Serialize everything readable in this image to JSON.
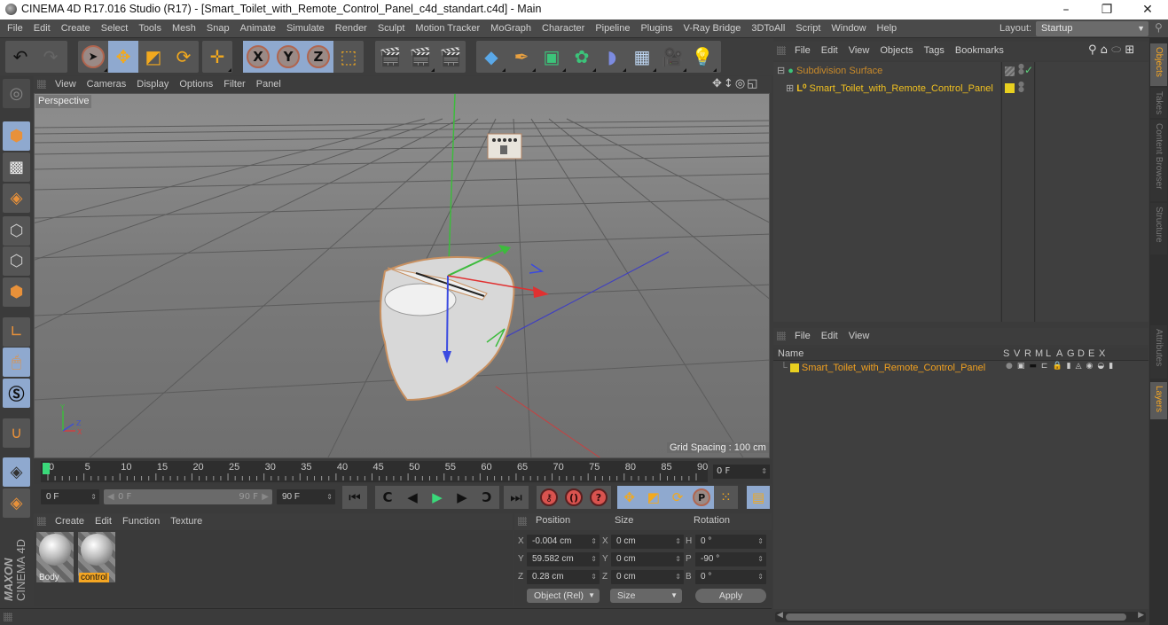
{
  "window": {
    "title": "CINEMA 4D R17.016 Studio (R17) - [Smart_Toilet_with_Remote_Control_Panel_c4d_standart.c4d] - Main",
    "controls": {
      "minimize": "–",
      "restore": "❐",
      "close": "✕"
    }
  },
  "menubar": {
    "items": [
      "File",
      "Edit",
      "Create",
      "Select",
      "Tools",
      "Mesh",
      "Snap",
      "Animate",
      "Simulate",
      "Render",
      "Sculpt",
      "Motion Tracker",
      "MoGraph",
      "Character",
      "Pipeline",
      "Plugins",
      "V-Ray Bridge",
      "3DToAll",
      "Script",
      "Window",
      "Help"
    ],
    "layout_label": "Layout:",
    "layout_value": "Startup"
  },
  "toolbar": {
    "undo_icon": "undo-icon",
    "redo_icon": "redo-icon",
    "tools": [
      "live-selection",
      "move",
      "scale",
      "rotate",
      "recent-tool"
    ],
    "axes": [
      "X",
      "Y",
      "Z"
    ],
    "coord_system_icon": "world-coordinates-icon",
    "render": [
      "render-view",
      "render-picture-viewer",
      "edit-render-settings"
    ],
    "create": [
      "cube",
      "pen-spline",
      "subdivision-surface",
      "cloner",
      "bend-deformer",
      "floor",
      "camera",
      "light"
    ]
  },
  "left_tools": [
    "make-editable",
    "texture-mode",
    "workplane",
    "points-mode",
    "edges-mode",
    "polygons-mode",
    "enable-axis",
    "tweak-mode",
    "snapping",
    "magnet",
    "locked-workplane",
    "planar-workplane"
  ],
  "viewport": {
    "menu": [
      "View",
      "Cameras",
      "Display",
      "Options",
      "Filter",
      "Panel"
    ],
    "camera_label": "Perspective",
    "grid_spacing": "Grid Spacing : 100 cm"
  },
  "timeline": {
    "ticks": [
      "0",
      "5",
      "10",
      "15",
      "20",
      "25",
      "30",
      "35",
      "40",
      "45",
      "50",
      "55",
      "60",
      "65",
      "70",
      "75",
      "80",
      "85",
      "90"
    ],
    "current_frame_display": "0 F",
    "start_field": "0 F",
    "range_start": "0 F",
    "range_end": "90 F",
    "end_field": "90 F"
  },
  "playback": {
    "buttons": [
      "go-to-start",
      "go-to-previous-key",
      "play-backwards",
      "play-forwards",
      "go-to-next-key",
      "go-to-end"
    ],
    "record": [
      "record-active-objects",
      "autokeying",
      "keyframe-selection"
    ],
    "key_tracks": [
      "position",
      "scale",
      "rotation",
      "parameter",
      "point-level-animation"
    ],
    "timeline_icon": "timeline-icon"
  },
  "materials": {
    "menu": [
      "Create",
      "Edit",
      "Function",
      "Texture"
    ],
    "items": [
      {
        "name": "Body",
        "selected": false
      },
      {
        "name": "control",
        "selected": true
      }
    ],
    "brand_top": "MAXON",
    "brand_bottom": "CINEMA 4D"
  },
  "coordinates": {
    "headers": {
      "position": "Position",
      "size": "Size",
      "rotation": "Rotation"
    },
    "rows": [
      {
        "pos_axis": "X",
        "pos": "-0.004 cm",
        "size_axis": "X",
        "size": "0 cm",
        "rot_axis": "H",
        "rot": "0 °"
      },
      {
        "pos_axis": "Y",
        "pos": "59.582 cm",
        "size_axis": "Y",
        "size": "0 cm",
        "rot_axis": "P",
        "rot": "-90 °"
      },
      {
        "pos_axis": "Z",
        "pos": "0.28 cm",
        "size_axis": "Z",
        "size": "0 cm",
        "rot_axis": "B",
        "rot": "0 °"
      }
    ],
    "mode_select": "Object (Rel)",
    "size_select": "Size",
    "apply_label": "Apply"
  },
  "object_manager": {
    "menu": [
      "File",
      "Edit",
      "View",
      "Objects",
      "Tags",
      "Bookmarks"
    ],
    "objects": [
      {
        "name": "Subdivision Surface",
        "color": "#c98a2a",
        "level": 0
      },
      {
        "name": "Smart_Toilet_with_Remote_Control_Panel",
        "color": "#f0c020",
        "level": 1
      }
    ]
  },
  "right_tabs": {
    "top": [
      {
        "label": "Objects",
        "active": true
      },
      {
        "label": "Takes",
        "active": false
      },
      {
        "label": "Content Browser",
        "active": false
      },
      {
        "label": "Structure",
        "active": false
      }
    ],
    "bottom": [
      {
        "label": "Attributes",
        "active": false
      },
      {
        "label": "Layers",
        "active": true
      }
    ]
  },
  "layer_manager": {
    "menu": [
      "File",
      "Edit",
      "View"
    ],
    "name_header": "Name",
    "columns": [
      "S",
      "V",
      "R",
      "M",
      "L",
      "A",
      "G",
      "D",
      "E",
      "X"
    ],
    "layers": [
      {
        "name": "Smart_Toilet_with_Remote_Control_Panel",
        "color": "#e8d020"
      }
    ]
  },
  "colors": {
    "accent_orange": "#f5a623",
    "active_blue": "#8fa9cf",
    "play_green": "#3ad97a",
    "record_red": "#d9534f"
  }
}
